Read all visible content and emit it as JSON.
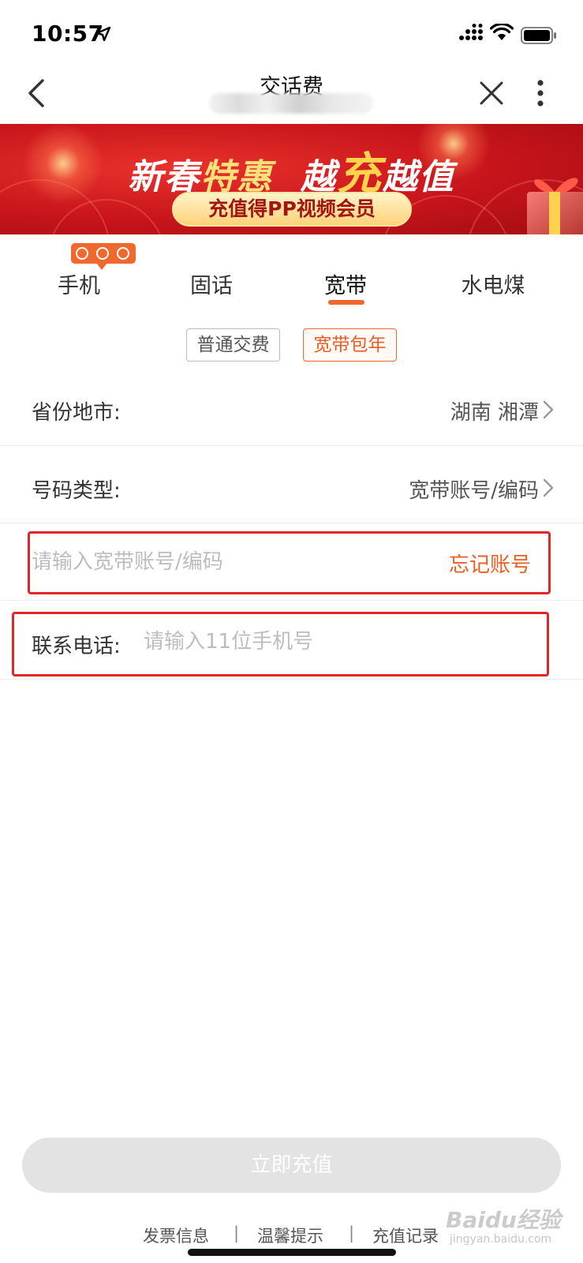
{
  "status_bar": {
    "time": "10:57"
  },
  "nav": {
    "title": "交话费"
  },
  "banner": {
    "headline_part1": "新春",
    "headline_part2": "特惠",
    "headline_part3": "越",
    "headline_part4": "充",
    "headline_part5": "越值",
    "pill_text": "充值得PP视频会员"
  },
  "tabs": [
    {
      "label": "手机",
      "active": false
    },
    {
      "label": "固话",
      "active": false
    },
    {
      "label": "宽带",
      "active": true
    },
    {
      "label": "水电煤",
      "active": false
    }
  ],
  "sub_options": {
    "normal": "普通交费",
    "yearly": "宽带包年",
    "selected": "宽带包年"
  },
  "form": {
    "province": {
      "label": "省份地市:",
      "value": "湖南 湘潭"
    },
    "number_type": {
      "label": "号码类型:",
      "value": "宽带账号/编码"
    },
    "account": {
      "value": "",
      "placeholder": "请输入宽带账号/编码",
      "forgot_label": "忘记账号"
    },
    "phone": {
      "label": "联系电话:",
      "value": "",
      "placeholder": "请输入11位手机号"
    }
  },
  "submit": {
    "label": "立即充值"
  },
  "footer": {
    "links": [
      "发票信息",
      "温馨提示",
      "充值记录"
    ],
    "separator": "|"
  },
  "watermark": {
    "text": "Baidu经验",
    "sub": "jingyan.baidu.com"
  },
  "colors": {
    "accent": "#f0682e",
    "highlight_border": "#e0262a",
    "banner_red": "#c8141b",
    "submit_disabled": "#e3e3e3"
  }
}
